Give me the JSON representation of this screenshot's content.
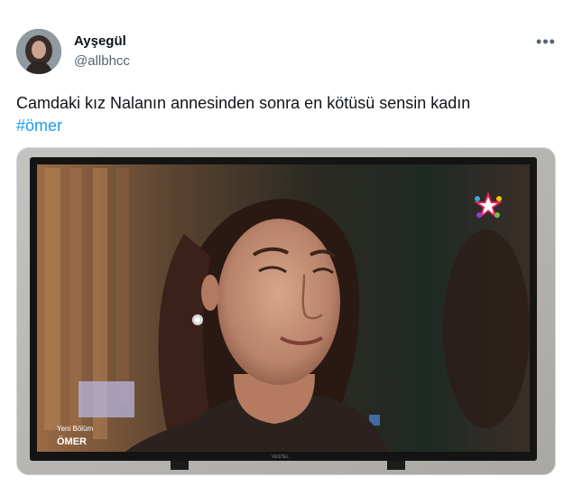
{
  "author": {
    "display_name": "Ayşegül",
    "handle": "@allbhcc",
    "avatar_icon": "profile-avatar"
  },
  "menu": {
    "more_label": "•••",
    "more_icon": "more-horizontal-icon"
  },
  "tweet": {
    "text": "Camdaki kız Nalanın annesinden sonra en kötüsü sensin kadın",
    "hashtag": "#ömer"
  },
  "media": {
    "tv_overlay_line1": "Yeni Bölüm",
    "tv_overlay_line2": "ÖMER",
    "tv_brand": "VESTEL",
    "channel_logo_icon": "star-tv-logo-icon"
  },
  "colors": {
    "link": "#1d9bf0",
    "secondary_text": "#536471",
    "primary_text": "#0f1419"
  }
}
